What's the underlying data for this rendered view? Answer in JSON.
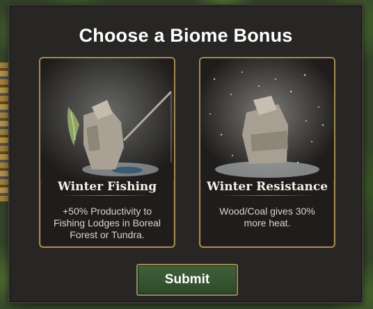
{
  "dialog": {
    "title": "Choose a Biome Bonus",
    "submit_label": "Submit"
  },
  "cards": [
    {
      "title": "Winter Fishing",
      "description": "+50% Productivity to Fishing Lodges in Boreal Forest or Tundra.",
      "icon": "ice-fisherman-art"
    },
    {
      "title": "Winter Resistance",
      "description": "Wood/Coal gives 30% more heat.",
      "icon": "bundled-figure-in-snow-art"
    }
  ],
  "colors": {
    "card_border": "#a88a4c",
    "submit_bg": "#3a5a33",
    "dialog_bg": "#272625"
  }
}
